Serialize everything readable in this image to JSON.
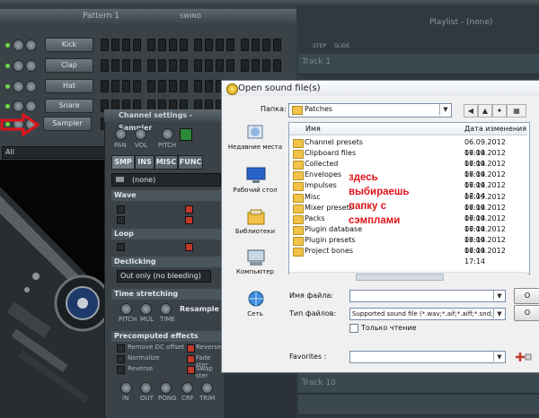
{
  "pattern": {
    "title": "Pattern 1",
    "swing_label": "SWING",
    "all_select": "All"
  },
  "channels": [
    {
      "label": "Kick"
    },
    {
      "label": "Clap"
    },
    {
      "label": "Hat"
    },
    {
      "label": "Snare"
    },
    {
      "label": "Sampler"
    }
  ],
  "channel_settings": {
    "title": "Channel settings - Sampler",
    "knobs": [
      "PAN",
      "VOL",
      "PITCH"
    ],
    "tabs": [
      "SMP",
      "INS",
      "MISC",
      "FUNC"
    ],
    "sample": "(none)",
    "wave_section": "Wave",
    "loop_section": "Loop",
    "declicking_section": "Declicking",
    "declicking_value": "Out only (no bleeding)",
    "time_stretching_section": "Time stretching",
    "ts_knobs": [
      "PITCH",
      "MUL",
      "TIME"
    ],
    "resample": "Resample",
    "precomputed_section": "Precomputed effects",
    "effects": [
      "Remove DC offset",
      "Normalize",
      "Reverse"
    ],
    "effects_right": [
      "Reverse",
      "Fade ster",
      "Swap ster"
    ],
    "bottom_knobs": [
      "IN",
      "OUT",
      "PONG",
      "CRF",
      "TRIM"
    ]
  },
  "playlist": {
    "title": "Playlist - (none)",
    "step": "STEP",
    "slide": "SLIDE",
    "track1": "Track 1",
    "track10": "Track 10"
  },
  "dialog": {
    "title": "Open sound file(s)",
    "folder_label": "Папка:",
    "folder_value": "Patches",
    "col_name": "Имя",
    "col_date": "Дата изменения",
    "places": [
      {
        "label": "Недавние места"
      },
      {
        "label": "Рабочий стол"
      },
      {
        "label": "Библиотеки"
      },
      {
        "label": "Компьютер"
      },
      {
        "label": "Сеть"
      }
    ],
    "rows": [
      {
        "name": "Channel presets",
        "date": "06.09.2012 17:14"
      },
      {
        "name": "Clipboard files",
        "date": "06.09.2012 17:14"
      },
      {
        "name": "Collected",
        "date": "06.09.2012 17:14"
      },
      {
        "name": "Envelopes",
        "date": "06.09.2012 17:14"
      },
      {
        "name": "Impulses",
        "date": "06.09.2012 17:14"
      },
      {
        "name": "Misc",
        "date": "06.09.2012 17:14"
      },
      {
        "name": "Mixer presets",
        "date": "06.09.2012 17:14"
      },
      {
        "name": "Packs",
        "date": "06.09.2012 17:14"
      },
      {
        "name": "Plugin database",
        "date": "06.09.2012 17:14"
      },
      {
        "name": "Plugin presets",
        "date": "06.09.2012 17:14"
      },
      {
        "name": "Project bones",
        "date": "06.09.2012 17:14"
      }
    ],
    "annotation": "здесь выбираешь папку с сэмплами",
    "filename_label": "Имя файла:",
    "filetype_label": "Тип файлов:",
    "filetype_value": "Supported sound file (*.wav;*.aif;*.aiff;*.snd;*.wv",
    "readonly_label": "Только чтение",
    "favorites_label": "Favorites :",
    "btn_open": "O",
    "btn_cancel": "O"
  },
  "colors": {
    "annotation": "#e0141b",
    "arrow": "#e0141b"
  }
}
